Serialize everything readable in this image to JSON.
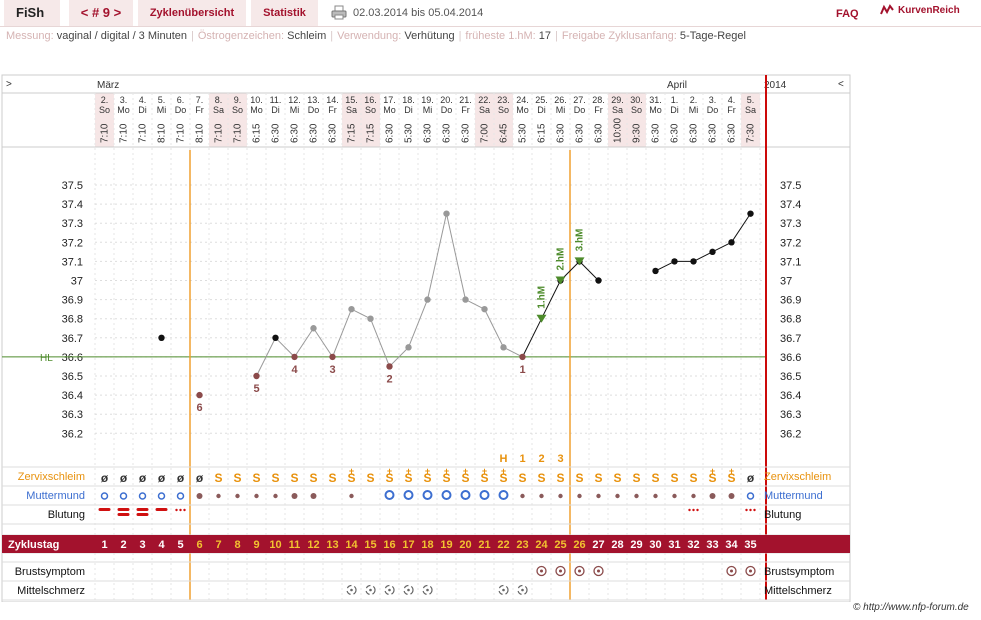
{
  "header": {
    "brand": "FiSh",
    "cycle_tab": "< # 9 >",
    "overview_tab": "Zyklenübersicht",
    "stats_tab": "Statistik",
    "date_range": "02.03.2014 bis 05.04.2014",
    "faq": "FAQ",
    "logo_text": "KurvenReich"
  },
  "meta": [
    {
      "label": "Messung:",
      "value": "vaginal / digital / 3 Minuten"
    },
    {
      "label": "Östrogenzeichen:",
      "value": "Schleim"
    },
    {
      "label": "Verwendung:",
      "value": "Verhütung"
    },
    {
      "label": "früheste 1.hM:",
      "value": "17"
    },
    {
      "label": "Freigabe Zyklusanfang:",
      "value": "5-Tage-Regel"
    }
  ],
  "chart_nav": {
    "left": ">",
    "right": "<",
    "year": "2014"
  },
  "months": [
    {
      "label": "März",
      "day_index": 0
    },
    {
      "label": "April",
      "day_index": 30
    }
  ],
  "days": [
    {
      "d": "2.",
      "wd": "So",
      "time": "7:10"
    },
    {
      "d": "3.",
      "wd": "Mo",
      "time": "7:10"
    },
    {
      "d": "4.",
      "wd": "Di",
      "time": "7:10"
    },
    {
      "d": "5.",
      "wd": "Mi",
      "time": "8:10"
    },
    {
      "d": "6.",
      "wd": "Do",
      "time": "7:10"
    },
    {
      "d": "7.",
      "wd": "Fr",
      "time": "8:10"
    },
    {
      "d": "8.",
      "wd": "Sa",
      "time": "7:10"
    },
    {
      "d": "9.",
      "wd": "So",
      "time": "7:10"
    },
    {
      "d": "10.",
      "wd": "Mo",
      "time": "6:15"
    },
    {
      "d": "11.",
      "wd": "Di",
      "time": "6:30"
    },
    {
      "d": "12.",
      "wd": "Mi",
      "time": "6:30"
    },
    {
      "d": "13.",
      "wd": "Do",
      "time": "6:30"
    },
    {
      "d": "14.",
      "wd": "Fr",
      "time": "6:30"
    },
    {
      "d": "15.",
      "wd": "Sa",
      "time": "7:15"
    },
    {
      "d": "16.",
      "wd": "So",
      "time": "7:15"
    },
    {
      "d": "17.",
      "wd": "Mo",
      "time": "6:30"
    },
    {
      "d": "18.",
      "wd": "Di",
      "time": "5:30"
    },
    {
      "d": "19.",
      "wd": "Mi",
      "time": "6:30"
    },
    {
      "d": "20.",
      "wd": "Do",
      "time": "6:30"
    },
    {
      "d": "21.",
      "wd": "Fr",
      "time": "6:30"
    },
    {
      "d": "22.",
      "wd": "Sa",
      "time": "7:00"
    },
    {
      "d": "23.",
      "wd": "So",
      "time": "6:45"
    },
    {
      "d": "24.",
      "wd": "Mo",
      "time": "5:30"
    },
    {
      "d": "25.",
      "wd": "Di",
      "time": "6:15"
    },
    {
      "d": "26.",
      "wd": "Mi",
      "time": "6:30"
    },
    {
      "d": "27.",
      "wd": "Do",
      "time": "6:30"
    },
    {
      "d": "28.",
      "wd": "Fr",
      "time": "6:30"
    },
    {
      "d": "29.",
      "wd": "Sa",
      "time": "10:00"
    },
    {
      "d": "30.",
      "wd": "So",
      "time": "9:30"
    },
    {
      "d": "31.",
      "wd": "Mo",
      "time": "6:30"
    },
    {
      "d": "1.",
      "wd": "Di",
      "time": "6:30"
    },
    {
      "d": "2.",
      "wd": "Mi",
      "time": "6:30"
    },
    {
      "d": "3.",
      "wd": "Do",
      "time": "6:30"
    },
    {
      "d": "4.",
      "wd": "Fr",
      "time": "6:30"
    },
    {
      "d": "5.",
      "wd": "Sa",
      "time": "7:30"
    }
  ],
  "weekend_indices": [
    0,
    6,
    7,
    13,
    14,
    20,
    21,
    27,
    28,
    34
  ],
  "chart_data": {
    "type": "line",
    "y_ticks": [
      "37.5",
      "37.4",
      "37.3",
      "37.2",
      "37.1",
      "37",
      "36.9",
      "36.8",
      "36.7",
      "36.6",
      "36.5",
      "36.4",
      "36.3",
      "36.2"
    ],
    "ylim": [
      36.1,
      37.6
    ],
    "hl_label": "HL",
    "hl_value": 36.6,
    "temperatures": [
      null,
      null,
      null,
      36.7,
      null,
      36.4,
      null,
      null,
      36.5,
      36.7,
      36.6,
      36.75,
      36.6,
      36.85,
      36.8,
      36.55,
      36.65,
      36.9,
      37.35,
      36.9,
      36.85,
      36.65,
      36.6,
      36.8,
      37.0,
      37.1,
      37.0,
      null,
      null,
      37.05,
      37.1,
      37.1,
      37.15,
      37.2,
      37.35
    ],
    "excluded_indices": [
      10,
      11,
      12,
      13,
      14,
      15,
      16,
      17,
      18,
      19,
      20,
      21,
      22
    ],
    "low_labels": [
      {
        "i": 5,
        "n": "6"
      },
      {
        "i": 8,
        "n": "5"
      },
      {
        "i": 10,
        "n": "4"
      },
      {
        "i": 12,
        "n": "3"
      },
      {
        "i": 15,
        "n": "2"
      },
      {
        "i": 22,
        "n": "1"
      }
    ],
    "high_markers": [
      {
        "i": 23,
        "label": "1.hM"
      },
      {
        "i": 24,
        "label": "2.hM"
      },
      {
        "i": 25,
        "label": "3.hM"
      }
    ],
    "peak_marks": [
      {
        "i": 21,
        "t": "H"
      },
      {
        "i": 22,
        "t": "1"
      },
      {
        "i": 23,
        "t": "2"
      },
      {
        "i": 24,
        "t": "3"
      }
    ],
    "cover_lines": [
      5,
      25
    ]
  },
  "rows": {
    "mucus_label": "Zervixschleim",
    "cervix_label": "Muttermund",
    "bleeding_label": "Blutung",
    "cycle_day_label": "Zyklustag",
    "breast_label": "Brustsymptom",
    "midpain_label": "Mittelschmerz"
  },
  "mucus": [
    "ø",
    "ø",
    "ø",
    "ø",
    "ø",
    "ø",
    "S",
    "S",
    "S",
    "S",
    "S",
    "S",
    "S",
    "S+",
    "S",
    "S+",
    "S+",
    "S+",
    "S+",
    "S+",
    "S+",
    "S+",
    "S",
    "S",
    "S",
    "S",
    "S",
    "S",
    "S",
    "S",
    "S",
    "S",
    "S+",
    "S+",
    "ø"
  ],
  "cervix": [
    "o",
    "o",
    "o",
    "o",
    "o",
    "°",
    "•",
    "•",
    "•",
    "•",
    "°",
    "°",
    "",
    "•",
    "",
    "O",
    "O",
    "O",
    "O",
    "O",
    "O",
    "O",
    "•",
    "•",
    "•",
    "•",
    "•",
    "•",
    "•",
    "•",
    "•",
    "•",
    "°",
    "°",
    "o"
  ],
  "bleeding": [
    2,
    3,
    3,
    2,
    1,
    0,
    0,
    0,
    0,
    0,
    0,
    0,
    0,
    0,
    0,
    0,
    0,
    0,
    0,
    0,
    0,
    0,
    0,
    0,
    0,
    0,
    0,
    0,
    0,
    0,
    0,
    1,
    0,
    0,
    1
  ],
  "breast": [
    23,
    24,
    25,
    26,
    33,
    34
  ],
  "midpain": [
    13,
    14,
    15,
    16,
    17,
    21,
    22
  ],
  "footer": "© http://www.nfp-forum.de",
  "colors": {
    "brand_red": "#a3122d",
    "mucus": "#e8920e",
    "cervix": "#3c6ed0",
    "fertile_num": "#f2c230",
    "green": "#4d8b2b",
    "line_red": "#cc0a0a",
    "low_label": "#8b4a4a",
    "weekend": "#f6e6e6"
  }
}
